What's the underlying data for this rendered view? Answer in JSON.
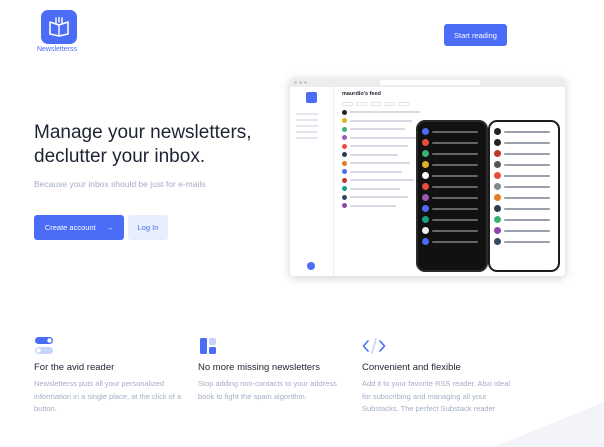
{
  "brand": {
    "name": "Newsletterss",
    "color": "#4a6cf7"
  },
  "header": {
    "cta_label": "Start reading"
  },
  "hero": {
    "title": "Manage your newsletters, declutter your inbox.",
    "subtitle": "Because your inbox should be just for e-mails",
    "primary_label": "Create account",
    "secondary_label": "Log In"
  },
  "mockup": {
    "feed_title": "maurdio's feed"
  },
  "features": [
    {
      "icon": "toggle-icon",
      "title": "For the avid reader",
      "text": "Newsletterss puts all your personalized information in a single place, at the click of a button."
    },
    {
      "icon": "blocks-icon",
      "title": "No more missing newsletters",
      "text": "Stop adding non-contacts to your address book to fight the spam algorithm."
    },
    {
      "icon": "code-icon",
      "title": "Convenient and flexible",
      "text": "Add it to your favorite RSS reader. Also ideal for subscribing and managing all your Substacks. The perfect Substack reader"
    }
  ]
}
